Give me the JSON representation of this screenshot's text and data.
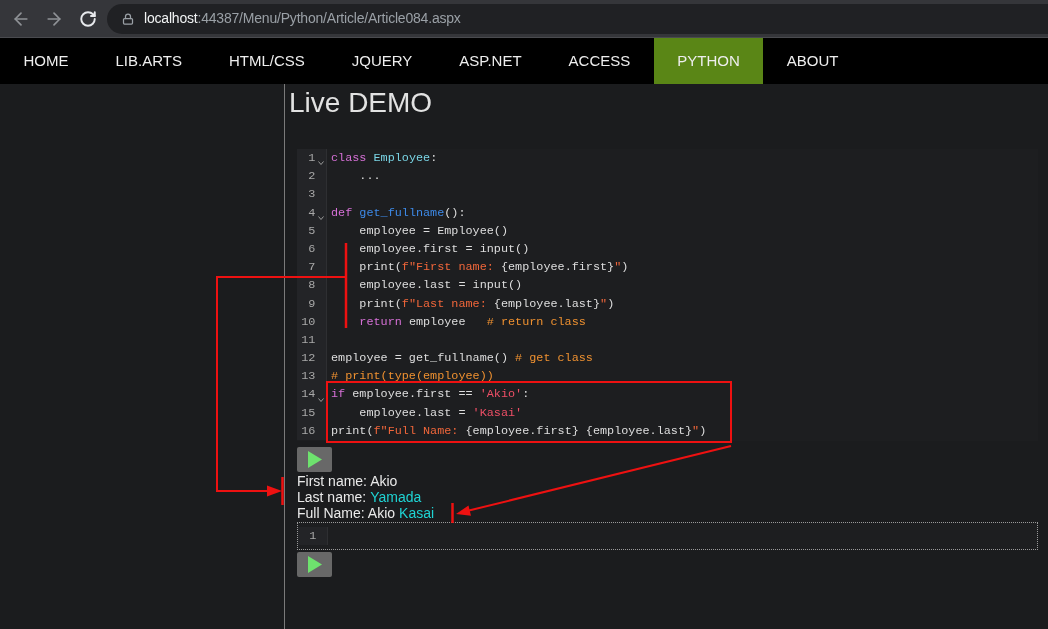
{
  "address_bar": {
    "host": "localhost",
    "path": ":44387/Menu/Python/Article/Article084.aspx"
  },
  "nav": {
    "items": [
      {
        "label": "HOME",
        "selected": false
      },
      {
        "label": "LIB.ARTS",
        "selected": false
      },
      {
        "label": "HTML/CSS",
        "selected": false
      },
      {
        "label": "JQUERY",
        "selected": false
      },
      {
        "label": "ASP.NET",
        "selected": false
      },
      {
        "label": "ACCESS",
        "selected": false
      },
      {
        "label": "PYTHON",
        "selected": true
      },
      {
        "label": "ABOUT",
        "selected": false
      }
    ]
  },
  "page_title": "Live DEMO",
  "cells": [
    {
      "editor": {
        "focused": false,
        "lines": [
          {
            "number": "1",
            "foldable": true,
            "tokens": [
              {
                "kind": "keyword",
                "text": "class "
              },
              {
                "kind": "class_name",
                "text": "Employee"
              },
              {
                "kind": "plain",
                "text": ":"
              }
            ]
          },
          {
            "number": "2",
            "foldable": false,
            "tokens": [
              {
                "kind": "plain",
                "text": "    ..."
              }
            ]
          },
          {
            "number": "3",
            "foldable": false
          },
          {
            "number": "4",
            "foldable": true,
            "tokens": [
              {
                "kind": "keyword",
                "text": "def "
              },
              {
                "kind": "function_name",
                "text": "get_fullname"
              },
              {
                "kind": "plain",
                "text": "():"
              }
            ]
          },
          {
            "number": "5",
            "foldable": false,
            "tokens": [
              {
                "kind": "plain",
                "text": "    employee = Employee()"
              }
            ]
          },
          {
            "number": "6",
            "foldable": false,
            "tokens": [
              {
                "kind": "plain",
                "text": "    employee.first = input()"
              }
            ]
          },
          {
            "number": "7",
            "foldable": false,
            "tokens": [
              {
                "kind": "plain",
                "text": "    print("
              },
              {
                "kind": "fstring",
                "text": "f\"First name: "
              },
              {
                "kind": "plain",
                "text": "{employee.first}"
              },
              {
                "kind": "fstring",
                "text": "\""
              },
              {
                "kind": "plain",
                "text": ")"
              }
            ]
          },
          {
            "number": "8",
            "foldable": false,
            "tokens": [
              {
                "kind": "plain",
                "text": "    employee.last = input()"
              }
            ]
          },
          {
            "number": "9",
            "foldable": false,
            "tokens": [
              {
                "kind": "plain",
                "text": "    print("
              },
              {
                "kind": "fstring",
                "text": "f\"Last name: "
              },
              {
                "kind": "plain",
                "text": "{employee.last}"
              },
              {
                "kind": "fstring",
                "text": "\""
              },
              {
                "kind": "plain",
                "text": ")"
              }
            ]
          },
          {
            "number": "10",
            "foldable": false,
            "tokens": [
              {
                "kind": "keyword",
                "text": "    return"
              },
              {
                "kind": "plain",
                "text": " employee   "
              },
              {
                "kind": "comment",
                "text": "# return class"
              }
            ]
          },
          {
            "number": "11",
            "foldable": false
          },
          {
            "number": "12",
            "foldable": false,
            "tokens": [
              {
                "kind": "plain",
                "text": "employee = get_fullname() "
              },
              {
                "kind": "comment",
                "text": "# get class"
              }
            ]
          },
          {
            "number": "13",
            "foldable": false,
            "tokens": [
              {
                "kind": "comment",
                "text": "# print(type(employee))"
              }
            ]
          },
          {
            "number": "14",
            "foldable": true,
            "tokens": [
              {
                "kind": "keyword",
                "text": "if"
              },
              {
                "kind": "plain",
                "text": " employee.first == "
              },
              {
                "kind": "string",
                "text": "'Akio'"
              },
              {
                "kind": "plain",
                "text": ":"
              }
            ]
          },
          {
            "number": "15",
            "foldable": false,
            "tokens": [
              {
                "kind": "plain",
                "text": "    employee.last = "
              },
              {
                "kind": "string",
                "text": "'Kasai'"
              }
            ]
          },
          {
            "number": "16",
            "foldable": false,
            "tokens": [
              {
                "kind": "plain",
                "text": "print("
              },
              {
                "kind": "fstring",
                "text": "f\"Full Name: "
              },
              {
                "kind": "plain",
                "text": "{employee.first} {employee.last}"
              },
              {
                "kind": "fstring",
                "text": "\""
              },
              {
                "kind": "plain",
                "text": ")"
              }
            ]
          }
        ]
      },
      "output": [
        {
          "segments": [
            {
              "text": "First name: Akio",
              "highlighted": false
            }
          ]
        },
        {
          "segments": [
            {
              "text": "Last name:",
              "highlighted": false
            },
            {
              "text": "Yamada",
              "highlighted": true
            }
          ]
        },
        {
          "segments": [
            {
              "text": "Full Name: Akio",
              "highlighted": false
            },
            {
              "text": "Kasai",
              "highlighted": true
            }
          ]
        }
      ]
    },
    {
      "editor": {
        "focused": true,
        "lines": [
          {
            "number": "1",
            "foldable": false
          }
        ]
      }
    }
  ]
}
